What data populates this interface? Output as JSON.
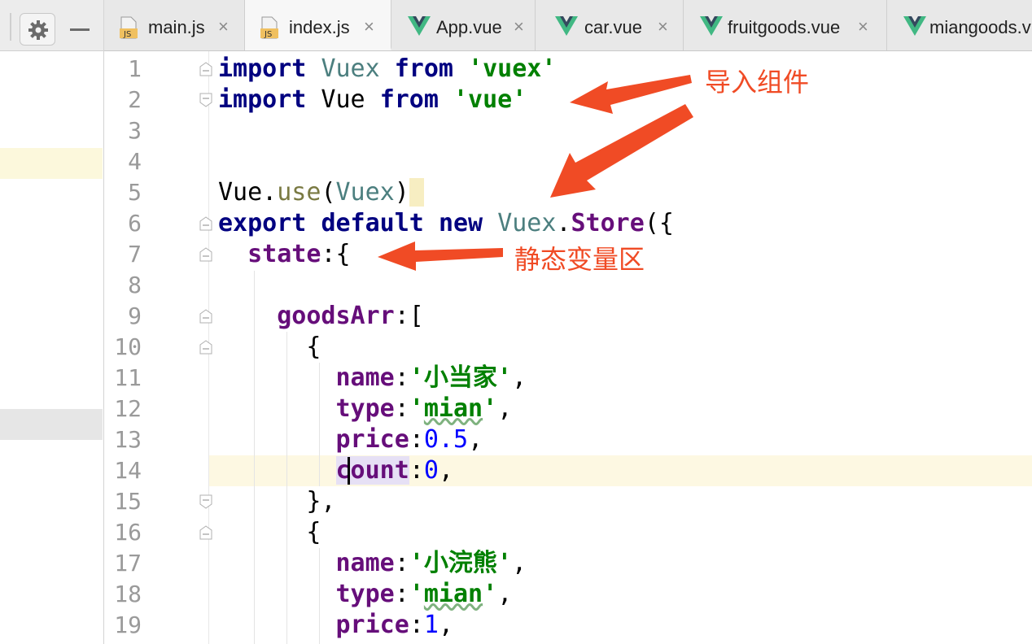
{
  "toolbar": {
    "settings_icon": "gear-icon",
    "minimize_icon": "minimize-icon"
  },
  "tabs": [
    {
      "label": "main.js",
      "icon": "js-file-icon",
      "active": false
    },
    {
      "label": "index.js",
      "icon": "js-file-icon",
      "active": true
    },
    {
      "label": "App.vue",
      "icon": "vue-file-icon",
      "active": false
    },
    {
      "label": "car.vue",
      "icon": "vue-file-icon",
      "active": false
    },
    {
      "label": "fruitgoods.vue",
      "icon": "vue-file-icon",
      "active": false
    },
    {
      "label": "miangoods.v",
      "icon": "vue-file-icon",
      "active": false
    }
  ],
  "tab_close_glyph": "×",
  "js_badge": "JS",
  "editor": {
    "line_numbers": [
      "1",
      "2",
      "3",
      "4",
      "5",
      "6",
      "7",
      "8",
      "9",
      "10",
      "11",
      "12",
      "13",
      "14",
      "15",
      "16",
      "17",
      "18",
      "19"
    ],
    "current_line": "14",
    "lines": [
      "import Vuex from 'vuex'",
      "import Vue from 'vue'",
      "",
      "",
      "Vue.use(Vuex)",
      "export default new Vuex.Store({",
      "  state:{",
      "",
      "    goodsArr:[",
      "      {",
      "        name:'小当家',",
      "        type:'mian',",
      "        price:0.5,",
      "        count:0,",
      "      },",
      "      {",
      "        name:'小浣熊',",
      "        type:'mian',",
      "        price:1,"
    ]
  },
  "annotations": {
    "import_components": "导入组件",
    "static_vars": "静态变量区"
  },
  "colors": {
    "keyword": "#000080",
    "string": "#008000",
    "property": "#660e7a",
    "number": "#0000ff",
    "class": "#4c7f7f",
    "annotation": "#f04b25",
    "current_line": "#fdf8e2"
  }
}
